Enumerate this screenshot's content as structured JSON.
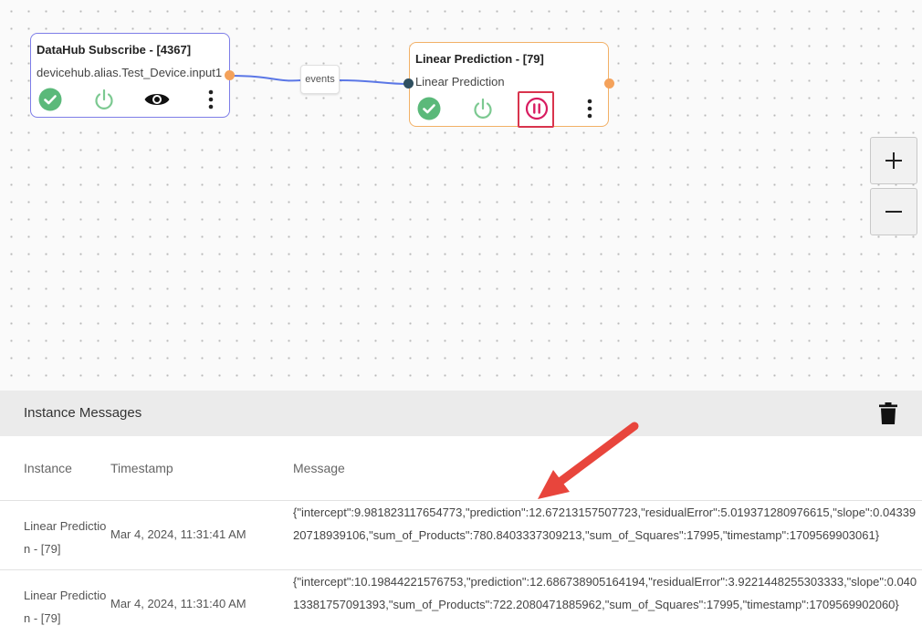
{
  "canvas": {
    "nodes": [
      {
        "title": "DataHub Subscribe - [4367]",
        "subtitle": "devicehub.alias.Test_Device.input1",
        "actions": [
          "check-circle-icon",
          "power-icon",
          "eye-icon",
          "more-vertical-icon"
        ]
      },
      {
        "title": "Linear Prediction - [79]",
        "subtitle": "Linear Prediction",
        "actions": [
          "check-circle-icon",
          "power-icon",
          "pause-circle-icon",
          "more-vertical-icon"
        ]
      }
    ],
    "edge_label": "events",
    "zoom_in": "+",
    "zoom_out": "−"
  },
  "colors": {
    "check": "#5bb97a",
    "power": "#7cc991",
    "pause": "#d81b60",
    "highlight": "#d9344d",
    "arrow": "#e8453c",
    "port_out": "#f4a25b",
    "wire": "#5b77e6"
  },
  "messages": {
    "title": "Instance Messages",
    "columns": [
      "Instance",
      "Timestamp",
      "Message"
    ],
    "rows": [
      {
        "instance": "Linear Prediction - [79]",
        "timestamp": "Mar 4, 2024, 11:31:41 AM",
        "message": "{\"intercept\":9.981823117654773,\"prediction\":12.67213157507723,\"residualError\":5.019371280976615,\"slope\":0.0433920718939106,\"sum_of_Products\":780.8403337309213,\"sum_of_Squares\":17995,\"timestamp\":1709569903061}"
      },
      {
        "instance": "Linear Prediction - [79]",
        "timestamp": "Mar 4, 2024, 11:31:40 AM",
        "message": "{\"intercept\":10.19844221576753,\"prediction\":12.686738905164194,\"residualError\":3.9221448255303333,\"slope\":0.04013381757091393,\"sum_of_Products\":722.2080471885962,\"sum_of_Squares\":17995,\"timestamp\":1709569902060}"
      }
    ]
  }
}
